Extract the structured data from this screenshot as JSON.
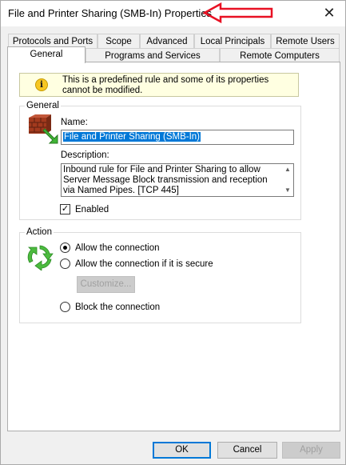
{
  "window": {
    "title": "File and Printer Sharing (SMB-In) Properties",
    "close_glyph": "✕"
  },
  "annotation": {
    "icon": "red-arrow-icon",
    "color": "#e81123"
  },
  "tabs": {
    "row_top": [
      "Protocols and Ports",
      "Scope",
      "Advanced",
      "Local Principals",
      "Remote Users"
    ],
    "row_bottom": [
      "General",
      "Programs and Services",
      "Remote Computers"
    ],
    "active": "General"
  },
  "info": {
    "icon": "info-icon",
    "glyph": "i",
    "text": "This is a predefined rule and some of its properties cannot be modified."
  },
  "general": {
    "legend": "General",
    "icon": "firewall-rule-icon",
    "name_label": "Name:",
    "name_value": "File and Printer Sharing (SMB-In)",
    "description_label": "Description:",
    "description_value": "Inbound rule for File and Printer Sharing to allow Server Message Block transmission and reception via Named Pipes. [TCP 445]",
    "enabled_label": "Enabled",
    "enabled": true
  },
  "action": {
    "legend": "Action",
    "icon": "action-cycle-icon",
    "options": [
      {
        "label": "Allow the connection",
        "selected": true
      },
      {
        "label": "Allow the connection if it is secure",
        "selected": false
      },
      {
        "label": "Block the connection",
        "selected": false
      }
    ],
    "customize_label": "Customize..."
  },
  "footer": {
    "ok_label": "OK",
    "cancel_label": "Cancel",
    "apply_label": "Apply"
  },
  "colors": {
    "accent": "#0078d7",
    "info_bg": "#ffffe1",
    "selection": "#0078d7"
  }
}
